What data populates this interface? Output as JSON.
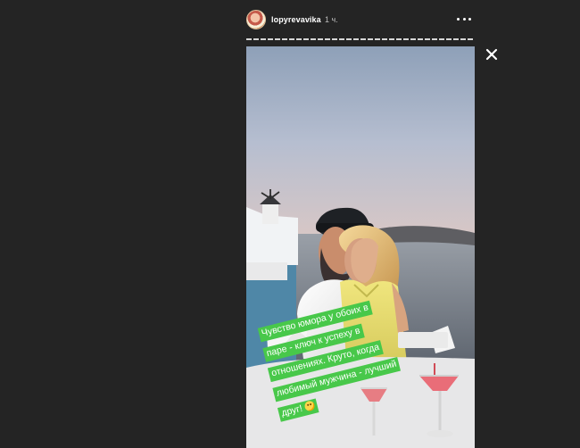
{
  "story": {
    "username": "lopyrevavika",
    "timestamp": "1 ч.",
    "caption": [
      "Чувство юмора у обоих в",
      "паре - ключ к успеху в",
      "отношениях. Круто, когда",
      "любимый мужчина - лучший",
      "друг!"
    ]
  },
  "icons": {
    "avatar": "profile-avatar",
    "more": "more-options-icon",
    "close": "close-icon"
  },
  "colors": {
    "background": "#242424",
    "caption_highlight": "#48c84a"
  }
}
